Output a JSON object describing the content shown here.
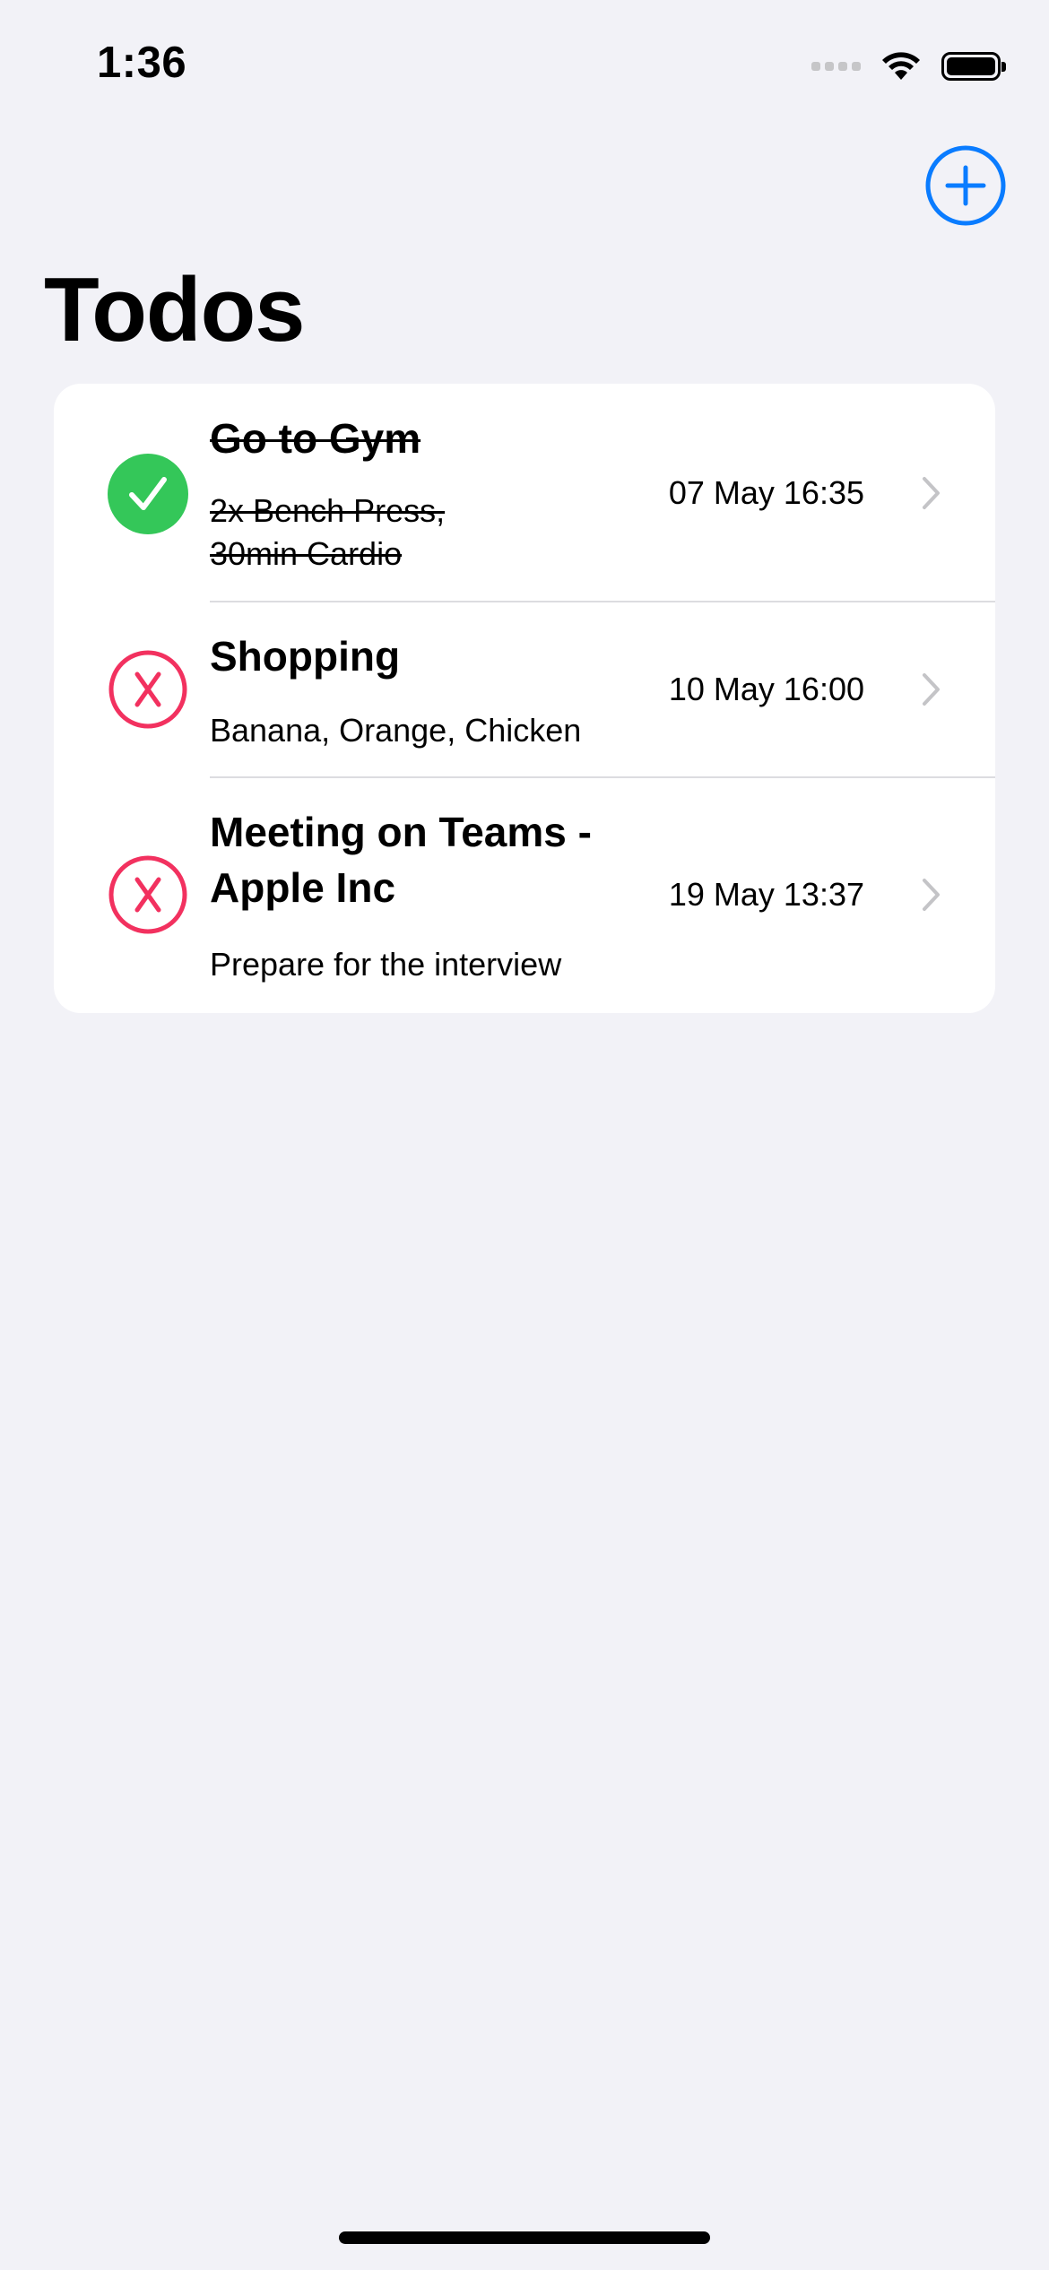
{
  "status_bar": {
    "time": "1:36"
  },
  "header": {
    "title": "Todos",
    "add_icon": "plus-circle-icon"
  },
  "colors": {
    "accent": "#0a7cff",
    "done": "#34c759",
    "pending": "#f2315f",
    "background": "#f2f2f7"
  },
  "todos": [
    {
      "title": "Go to Gym",
      "description": "2x Bench Press,\n30min Cardio",
      "date": "07 May 16:35",
      "completed": true,
      "status_icon": "checkmark-circle-icon"
    },
    {
      "title": "Shopping",
      "description": "Banana, Orange, Chicken",
      "date": "10 May 16:00",
      "completed": false,
      "status_icon": "x-circle-icon"
    },
    {
      "title": "Meeting on Teams - Apple Inc",
      "description": "Prepare for the interview",
      "date": "19 May 13:37",
      "completed": false,
      "status_icon": "x-circle-icon"
    }
  ]
}
